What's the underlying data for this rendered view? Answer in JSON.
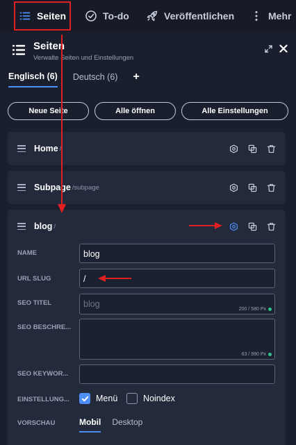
{
  "nav": {
    "items": [
      {
        "label": "Seiten",
        "icon": "list-icon"
      },
      {
        "label": "To-do",
        "icon": "check-circle-icon"
      },
      {
        "label": "Veröffentlichen",
        "icon": "rocket-icon"
      },
      {
        "label": "Mehr",
        "icon": "more-vertical-icon"
      }
    ]
  },
  "panel": {
    "title": "Seiten",
    "subtitle": "Verwalte Seiten und Einstellungen"
  },
  "languages": {
    "tabs": [
      {
        "label": "Englisch (6)",
        "active": true
      },
      {
        "label": "Deutsch (6)",
        "active": false
      }
    ],
    "add_label": "+"
  },
  "actions": {
    "new_page": "Neue Seite",
    "open_all": "Alle öffnen",
    "all_settings": "Alle Einstellungen"
  },
  "pages": [
    {
      "title": "Home",
      "slug": "/"
    },
    {
      "title": "Subpage",
      "slug": "/subpage"
    },
    {
      "title": "blog",
      "slug": "/"
    }
  ],
  "form": {
    "name_label": "NAME",
    "name_value": "blog",
    "url_label": "URL SLUG",
    "url_value": "/",
    "seo_title_label": "SEO TITEL",
    "seo_title_placeholder": "blog",
    "seo_title_counter": "200 / 580 Px",
    "seo_desc_label": "SEO BESCHRE...",
    "seo_desc_counter": "63 / 990 Px",
    "seo_keywords_label": "SEO KEYWOR...",
    "settings_label": "EINSTELLUNG...",
    "menu_label": "Menü",
    "menu_checked": true,
    "noindex_label": "Noindex",
    "noindex_checked": false,
    "preview_label": "VORSCHAU",
    "preview_tabs": [
      {
        "label": "Mobil",
        "active": true
      },
      {
        "label": "Desktop",
        "active": false
      }
    ]
  },
  "colors": {
    "accent": "#4f8ef7",
    "annotation": "#e02020",
    "ok": "#2ec48a"
  }
}
